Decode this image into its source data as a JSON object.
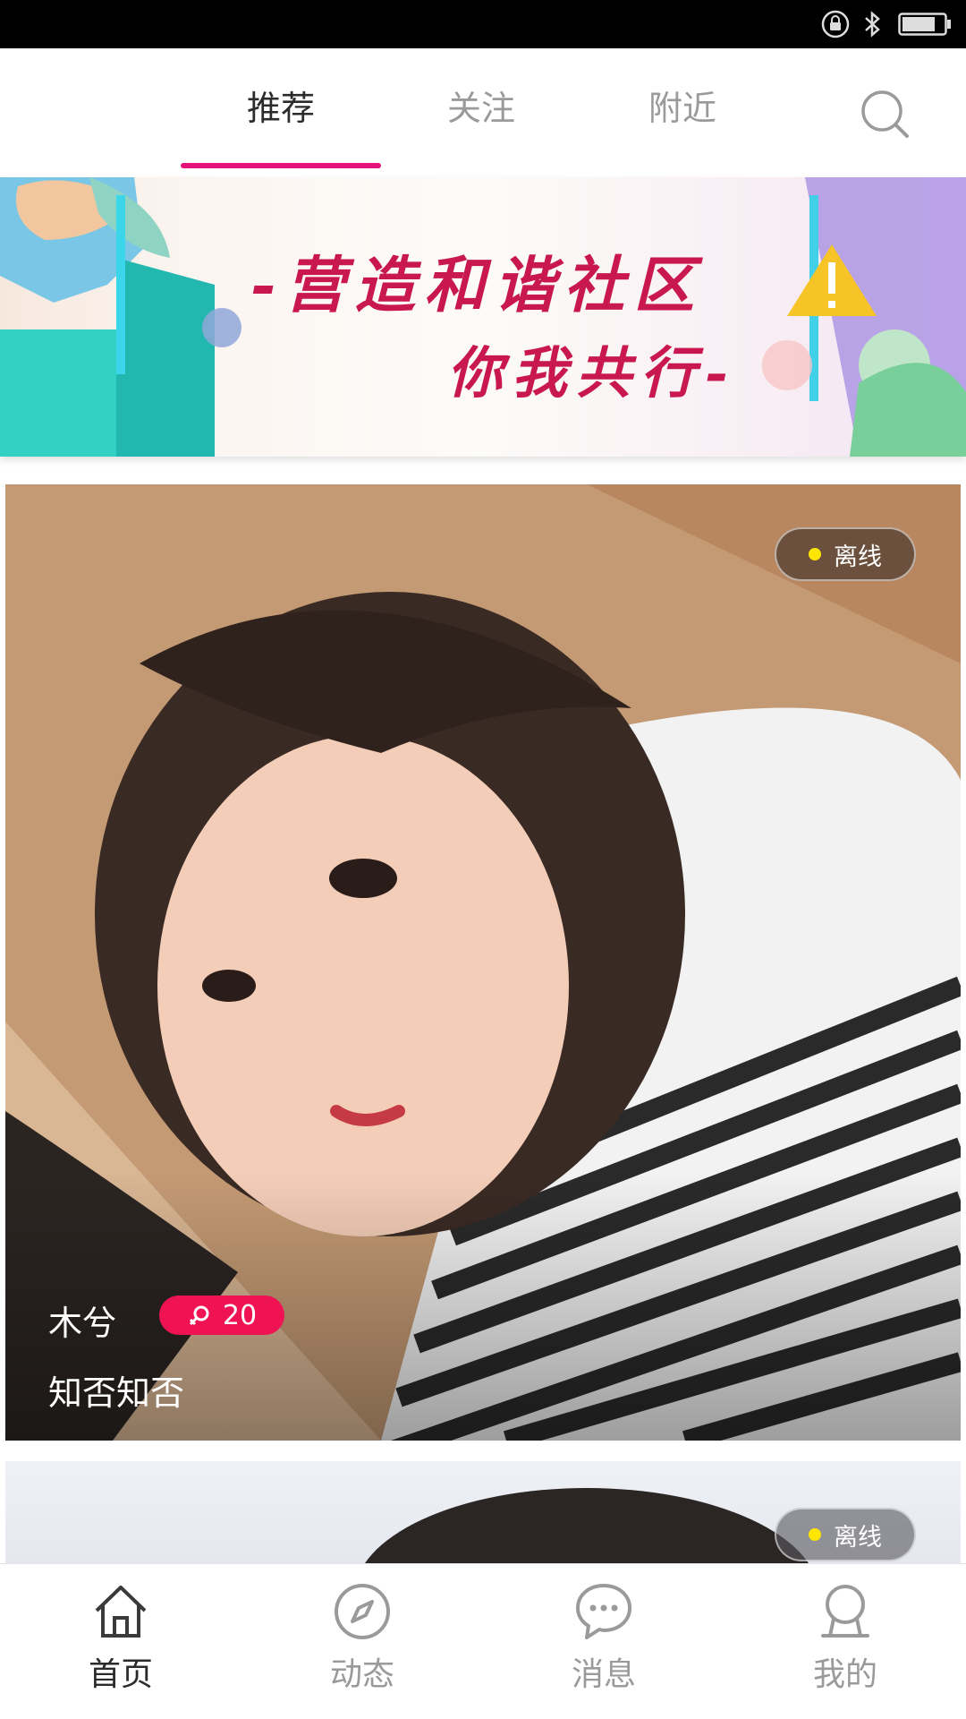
{
  "status_bar": {
    "icons": [
      "lock-rotation-icon",
      "bluetooth-icon",
      "battery-icon"
    ]
  },
  "top_tabs": [
    {
      "label": "推荐",
      "active": true
    },
    {
      "label": "关注",
      "active": false
    },
    {
      "label": "附近",
      "active": false
    }
  ],
  "search": {
    "icon": "search-icon"
  },
  "banner": {
    "line1": "-营造和谐社区",
    "line2": "你我共行-"
  },
  "feed": [
    {
      "status": "离线",
      "name": "木兮",
      "gender_icon": "female-icon",
      "age": "20",
      "bio": "知否知否"
    },
    {
      "status": "离线"
    }
  ],
  "bottom_nav": [
    {
      "label": "首页",
      "icon": "home-icon",
      "active": true
    },
    {
      "label": "动态",
      "icon": "compass-icon",
      "active": false
    },
    {
      "label": "消息",
      "icon": "chat-bubble-icon",
      "active": false
    },
    {
      "label": "我的",
      "icon": "profile-icon",
      "active": false
    }
  ],
  "colors": {
    "accent": "#e5127a",
    "age_badge": "#ef1354",
    "banner_text": "#c8184f",
    "status_dot": "#ffe600"
  }
}
